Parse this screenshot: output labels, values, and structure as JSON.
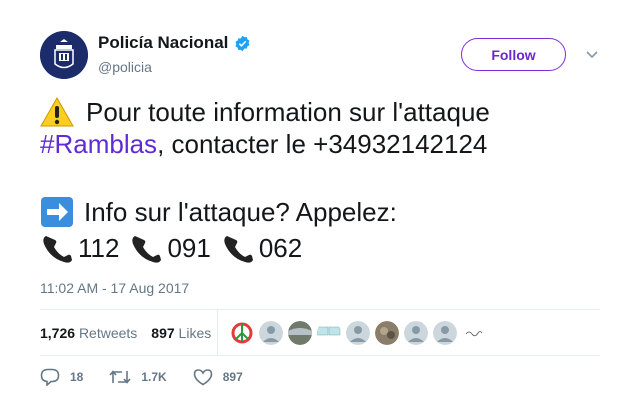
{
  "user": {
    "display_name": "Policía Nacional",
    "handle": "@policia"
  },
  "follow_label": "Follow",
  "tweet": {
    "line1": "Pour toute information sur l'attaque",
    "hashtag": "#Ramblas",
    "line2_rest": ", contacter le +34932142124",
    "line3": "Info sur l'attaque? Appelez:",
    "phones": [
      "112",
      "091",
      "062"
    ]
  },
  "timestamp": "11:02 AM - 17 Aug 2017",
  "stats": {
    "retweets_count": "1,726",
    "retweets_label": "Retweets",
    "likes_count": "897",
    "likes_label": "Likes"
  },
  "actions": {
    "replies": "18",
    "retweets": "1.7K",
    "likes": "897"
  },
  "colors": {
    "accent": "#6b28d0",
    "muted": "#657786",
    "verified": "#1da1f2"
  },
  "icons": [
    "police-badge-avatar",
    "verified-icon",
    "chevron-down-icon",
    "warning-icon",
    "right-arrow-icon",
    "telephone-icon",
    "reply-icon",
    "retweet-icon",
    "heart-icon"
  ]
}
